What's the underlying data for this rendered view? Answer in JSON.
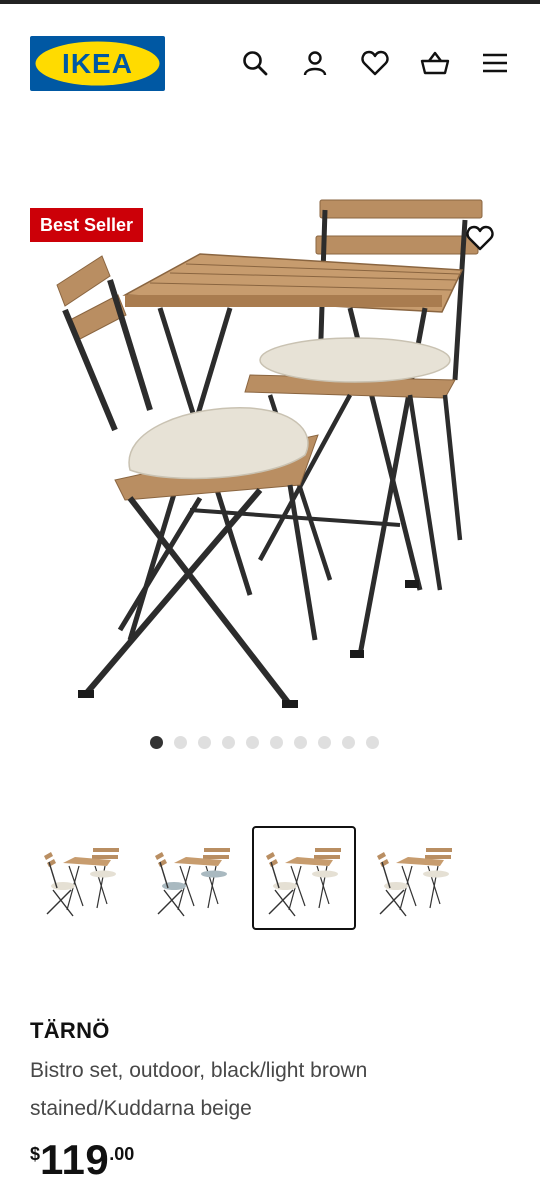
{
  "header": {
    "logo_text": "IKEA",
    "brand_colors": {
      "blue": "#0058a3",
      "yellow": "#ffdb00"
    },
    "icons": [
      "search-icon",
      "account-icon",
      "favourites-icon",
      "cart-icon",
      "menu-icon"
    ]
  },
  "gallery": {
    "badge": "Best Seller",
    "badge_color": "#cc0008",
    "image_count": 10,
    "active_image": 1,
    "thumbnail_count": 4,
    "selected_thumbnail": 3
  },
  "product": {
    "name": "TÄRNÖ",
    "description": "Bistro set, outdoor, black/light brown stained/Kuddarna beige",
    "price": {
      "currency": "$",
      "integer": "119",
      "decimals": ".00"
    }
  }
}
